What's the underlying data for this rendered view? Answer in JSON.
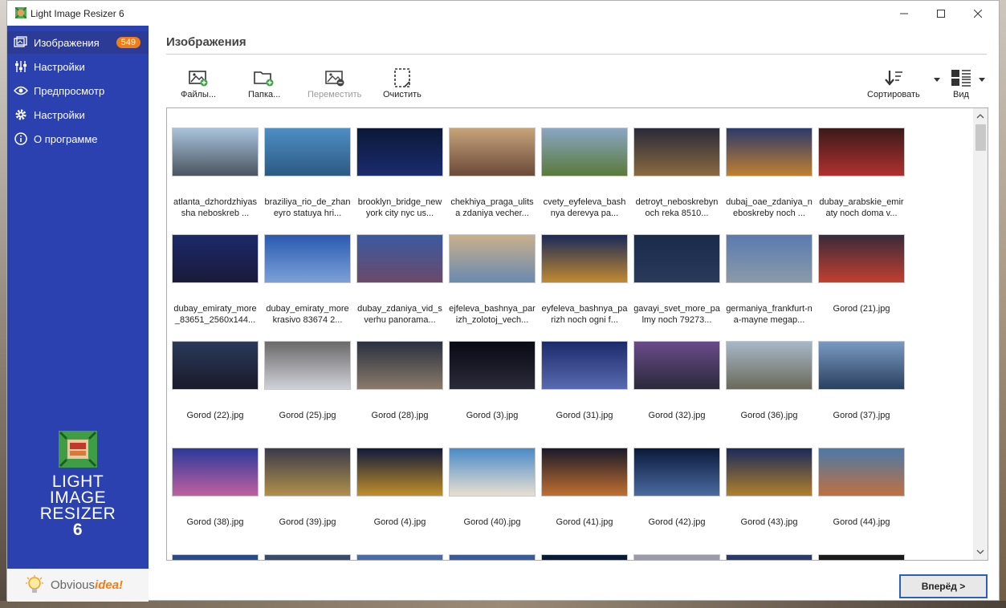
{
  "window": {
    "title": "Light Image Resizer 6"
  },
  "sidebar": {
    "items": [
      {
        "label": "Изображения",
        "icon": "images-icon",
        "badge": "549",
        "active": true
      },
      {
        "label": "Настройки",
        "icon": "sliders-icon"
      },
      {
        "label": "Предпросмотр",
        "icon": "eye-icon"
      },
      {
        "label": "Настройки",
        "icon": "gear-icon"
      },
      {
        "label": "О программе",
        "icon": "info-icon"
      }
    ],
    "logo_lines": [
      "LIGHT",
      "IMAGE",
      "RESIZER",
      "6"
    ],
    "brand": {
      "plain": "Obvious",
      "accent": "idea!"
    }
  },
  "main": {
    "title": "Изображения",
    "toolbar": {
      "files": "Файлы...",
      "folder": "Папка...",
      "move": "Переместить",
      "clear": "Очистить",
      "sort": "Сортировать",
      "view": "Вид"
    },
    "images": [
      {
        "caption": "atlanta_dzhordzhiyassha neboskreb ...",
        "c1": "#a9c3dd",
        "c2": "#4a5560"
      },
      {
        "caption": "braziliya_rio_de_zhaneyro statuya hri...",
        "c1": "#4d8ec4",
        "c2": "#2c5a82"
      },
      {
        "caption": "brooklyn_bridge_newyork city nyc us...",
        "c1": "#0c1838",
        "c2": "#1a2c6e"
      },
      {
        "caption": "chekhiya_praga_ulitsa zdaniya vecher...",
        "c1": "#c7a37a",
        "c2": "#6b4a3a"
      },
      {
        "caption": "cvety_eyfeleva_bashnya derevya pa...",
        "c1": "#8aa6c4",
        "c2": "#5a7a3a"
      },
      {
        "caption": "detroyt_neboskrebynoch reka 8510...",
        "c1": "#2a2a3a",
        "c2": "#8a6a40"
      },
      {
        "caption": "dubaj_oae_zdaniya_neboskreby noch ...",
        "c1": "#2c3a6a",
        "c2": "#c08030"
      },
      {
        "caption": "dubay_arabskie_emiraty noch doma v...",
        "c1": "#3a1a1a",
        "c2": "#b03030"
      },
      {
        "caption": "dubay_emiraty_more_83651_2560x144...",
        "c1": "#1c2a6a",
        "c2": "#1a1a3a"
      },
      {
        "caption": "dubay_emiraty_morekrasivo 83674 2...",
        "c1": "#2a5ab0",
        "c2": "#7ca0d8"
      },
      {
        "caption": "dubay_zdaniya_vid_sverhu panorama...",
        "c1": "#3a5aa0",
        "c2": "#6a4a6a"
      },
      {
        "caption": "ejfeleva_bashnya_parizh_zolotoj_vech...",
        "c1": "#c9b08a",
        "c2": "#6a8ab0"
      },
      {
        "caption": "eyfeleva_bashnya_parizh noch ogni f...",
        "c1": "#1a2a5a",
        "c2": "#c08a30"
      },
      {
        "caption": "gavayi_svet_more_palmy noch 79273...",
        "c1": "#1a2a4a",
        "c2": "#2a3a5a"
      },
      {
        "caption": "germaniya_frankfurt-na-mayne megap...",
        "c1": "#5a7ab0",
        "c2": "#8a9aa8"
      },
      {
        "caption": "Gorod  (21).jpg",
        "c1": "#3a2a3a",
        "c2": "#c04030"
      },
      {
        "caption": "Gorod  (22).jpg",
        "c1": "#2a3a5a",
        "c2": "#1a1a2a"
      },
      {
        "caption": "Gorod  (25).jpg",
        "c1": "#6a6a6a",
        "c2": "#d0d0d8"
      },
      {
        "caption": "Gorod  (28).jpg",
        "c1": "#2a3040",
        "c2": "#8a7a6a"
      },
      {
        "caption": "Gorod  (3).jpg",
        "c1": "#0a0a14",
        "c2": "#2a2a3a"
      },
      {
        "caption": "Gorod  (31).jpg",
        "c1": "#1a2a6a",
        "c2": "#5a6ab0"
      },
      {
        "caption": "Gorod  (32).jpg",
        "c1": "#6a4a8a",
        "c2": "#2a2a3a"
      },
      {
        "caption": "Gorod  (36).jpg",
        "c1": "#a8b8c8",
        "c2": "#6a6a5a"
      },
      {
        "caption": "Gorod  (37).jpg",
        "c1": "#7a9ac0",
        "c2": "#2a4060"
      },
      {
        "caption": "Gorod  (38).jpg",
        "c1": "#2a3a9a",
        "c2": "#c060a0"
      },
      {
        "caption": "Gorod  (39).jpg",
        "c1": "#3a3a4a",
        "c2": "#b0904a"
      },
      {
        "caption": "Gorod  (4).jpg",
        "c1": "#101a3a",
        "c2": "#c0902a"
      },
      {
        "caption": "Gorod  (40).jpg",
        "c1": "#4a8ac8",
        "c2": "#e8e0d0"
      },
      {
        "caption": "Gorod  (41).jpg",
        "c1": "#1a1a2a",
        "c2": "#c07030"
      },
      {
        "caption": "Gorod  (42).jpg",
        "c1": "#0a1a3a",
        "c2": "#4a6aa0"
      },
      {
        "caption": "Gorod  (43).jpg",
        "c1": "#1a2a5a",
        "c2": "#b0802a"
      },
      {
        "caption": "Gorod  (44).jpg",
        "c1": "#4a7aa8",
        "c2": "#c07040"
      }
    ],
    "partial_row_colors": [
      "#2a4a8a",
      "#3a4a6a",
      "#4a6aa8",
      "#3a5a9a",
      "#0a1a3a",
      "#9a9aa8",
      "#2a3a6a",
      "#1a1a1a"
    ]
  },
  "footer": {
    "next": "Вперёд >"
  }
}
